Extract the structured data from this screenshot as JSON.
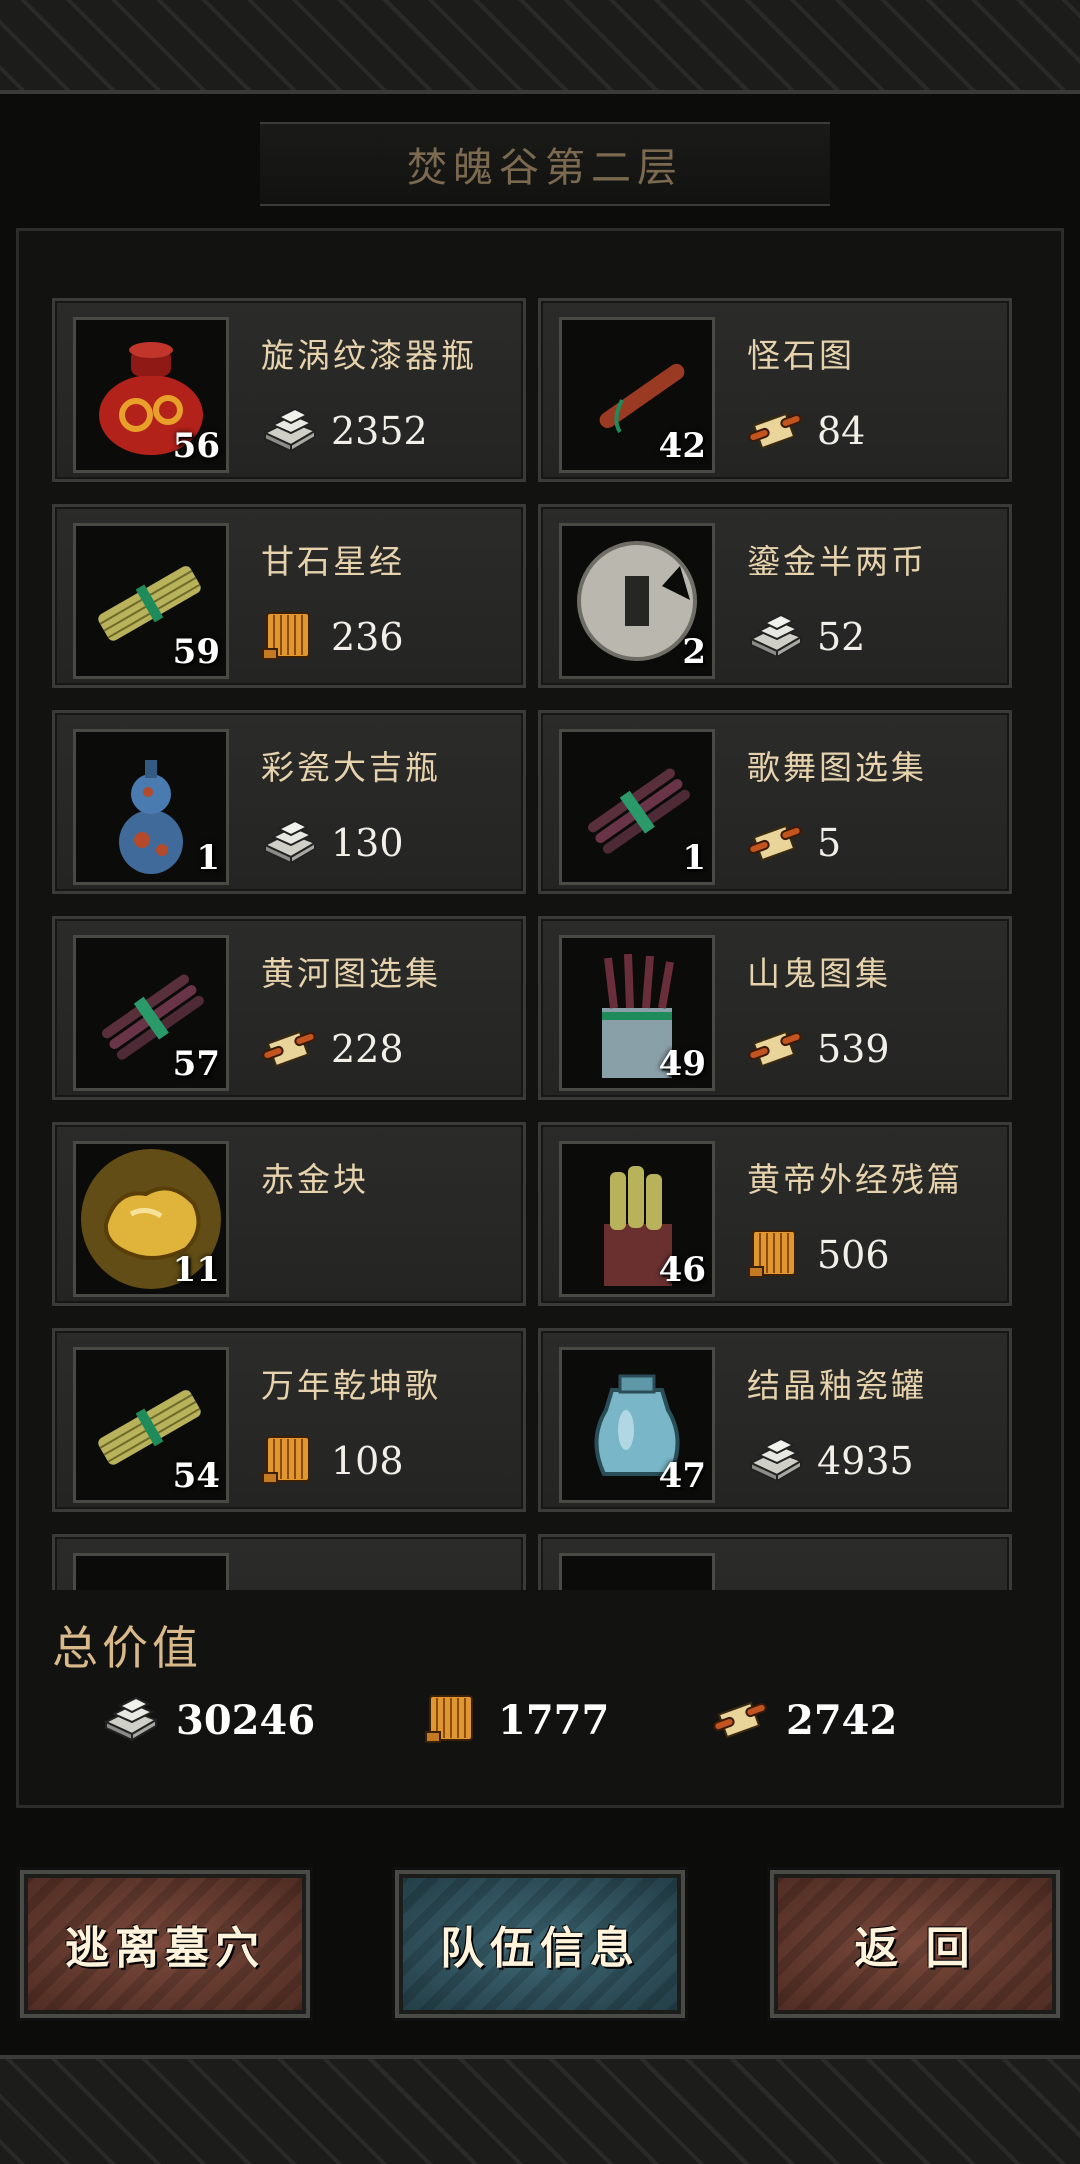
{
  "header": {
    "title": "焚魄谷第二层"
  },
  "items": [
    {
      "name": "旋涡纹漆器瓶",
      "count": "56",
      "currency": "silver",
      "value": "2352",
      "icon": "lacquer-jar-icon"
    },
    {
      "name": "怪石图",
      "count": "42",
      "currency": "scroll",
      "value": "84",
      "icon": "closed-scroll-icon"
    },
    {
      "name": "甘石星经",
      "count": "59",
      "currency": "book",
      "value": "236",
      "icon": "bamboo-scroll-icon"
    },
    {
      "name": "鎏金半两币",
      "count": "2",
      "currency": "silver",
      "value": "52",
      "icon": "coin-icon"
    },
    {
      "name": "彩瓷大吉瓶",
      "count": "1",
      "currency": "silver",
      "value": "130",
      "icon": "gourd-vase-icon"
    },
    {
      "name": "歌舞图选集",
      "count": "1",
      "currency": "scroll",
      "value": "5",
      "icon": "scroll-bundle-icon"
    },
    {
      "name": "黄河图选集",
      "count": "57",
      "currency": "scroll",
      "value": "228",
      "icon": "scroll-bundle-icon"
    },
    {
      "name": "山鬼图集",
      "count": "49",
      "currency": "scroll",
      "value": "539",
      "icon": "scroll-quiver-icon"
    },
    {
      "name": "赤金块",
      "count": "11",
      "currency": "",
      "value": "",
      "icon": "gold-nugget-icon"
    },
    {
      "name": "黄帝外经残篇",
      "count": "46",
      "currency": "book",
      "value": "506",
      "icon": "bamboo-bundle-icon"
    },
    {
      "name": "万年乾坤歌",
      "count": "54",
      "currency": "book",
      "value": "108",
      "icon": "bamboo-scroll-icon"
    },
    {
      "name": "结晶釉瓷罐",
      "count": "47",
      "currency": "silver",
      "value": "4935",
      "icon": "glaze-jar-icon"
    },
    {
      "name": "",
      "count": "",
      "currency": "",
      "value": "",
      "icon": ""
    },
    {
      "name": "",
      "count": "",
      "currency": "",
      "value": "",
      "icon": ""
    }
  ],
  "total": {
    "label": "总价值",
    "silver": "30246",
    "book": "1777",
    "scroll": "2742"
  },
  "buttons": {
    "escape": "逃离墓穴",
    "team": "队伍信息",
    "back": "返 回"
  },
  "colors": {
    "name_text": "#e6d3ad",
    "title_text": "#7b6a4f",
    "total_label": "#d9b98a"
  }
}
